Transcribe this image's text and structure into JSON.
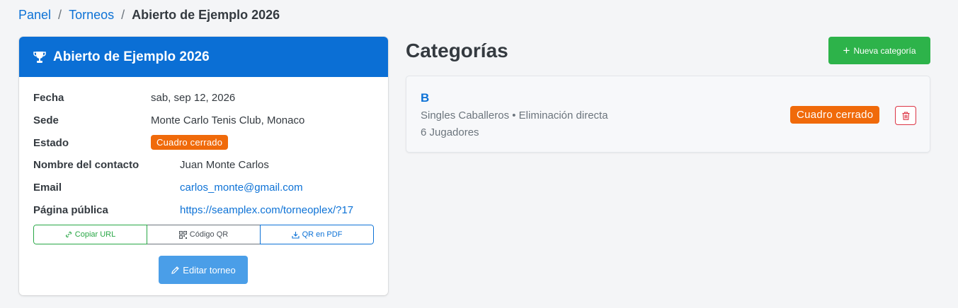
{
  "breadcrumb": {
    "items": [
      "Panel",
      "Torneos"
    ],
    "separator": "/",
    "current": "Abierto de Ejemplo 2026"
  },
  "tournament": {
    "title": "Abierto de Ejemplo 2026",
    "header_icon": "trophy-icon",
    "fields": {
      "fecha_label": "Fecha",
      "fecha_value": "sab, sep 12, 2026",
      "sede_label": "Sede",
      "sede_value": "Monte Carlo Tenis Club, Monaco",
      "estado_label": "Estado",
      "estado_value": "Cuadro cerrado",
      "contacto_label": "Nombre del contacto",
      "contacto_value": "Juan Monte Carlos",
      "email_label": "Email",
      "email_value": "carlos_monte@gmail.com",
      "publica_label": "Página pública",
      "publica_value": "https://seamplex.com/torneoplex/?17"
    },
    "actions": {
      "copy_url": "Copiar URL",
      "qr_code": "Código QR",
      "qr_pdf": "QR en PDF",
      "edit": "Editar torneo"
    }
  },
  "categories": {
    "title": "Categorías",
    "new_button": "Nueva categoría",
    "items": [
      {
        "name": "B",
        "description": "Singles Caballeros • Eliminación directa",
        "players": "6 Jugadores",
        "status": "Cuadro cerrado"
      }
    ]
  },
  "colors": {
    "primary": "#0b6fd5",
    "link": "#0d72d6",
    "success": "#2db34a",
    "warning_badge": "#f06a0a",
    "danger": "#dc3545",
    "edit_button": "#4a9ee8"
  }
}
